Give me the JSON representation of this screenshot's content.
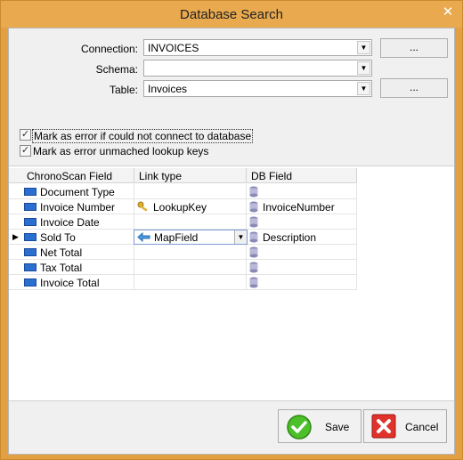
{
  "window": {
    "title": "Database Search",
    "close_symbol": "✕"
  },
  "form": {
    "connection_label": "Connection:",
    "connection_value": "INVOICES",
    "schema_label": "Schema:",
    "schema_value": "",
    "table_label": "Table:",
    "table_value": "Invoices",
    "browse_button_label": "...",
    "table_browse_button_label": "..."
  },
  "options": {
    "mark_error_connect_label": "Mark as error if could not connect to database",
    "mark_error_connect_checked": true,
    "mark_error_lookup_label": "Mark as error unmached lookup keys",
    "mark_error_lookup_checked": true
  },
  "grid": {
    "columns": [
      "ChronoScan Field",
      "Link type",
      "DB Field"
    ],
    "rows": [
      {
        "field": "Document Type",
        "link": "",
        "db": ""
      },
      {
        "field": "Invoice Number",
        "link": "LookupKey",
        "db": "InvoiceNumber"
      },
      {
        "field": "Invoice Date",
        "link": "",
        "db": ""
      },
      {
        "field": "Sold To",
        "link": "MapField",
        "db": "Description"
      },
      {
        "field": "Net Total",
        "link": "",
        "db": ""
      },
      {
        "field": "Tax Total",
        "link": "",
        "db": ""
      },
      {
        "field": "Invoice Total",
        "link": "",
        "db": ""
      }
    ],
    "selected_row": 3
  },
  "buttons": {
    "save_label": "Save",
    "cancel_label": "Cancel"
  },
  "colors": {
    "title_bar": "#e9a94e",
    "field_icon": "#2a6fd0"
  }
}
